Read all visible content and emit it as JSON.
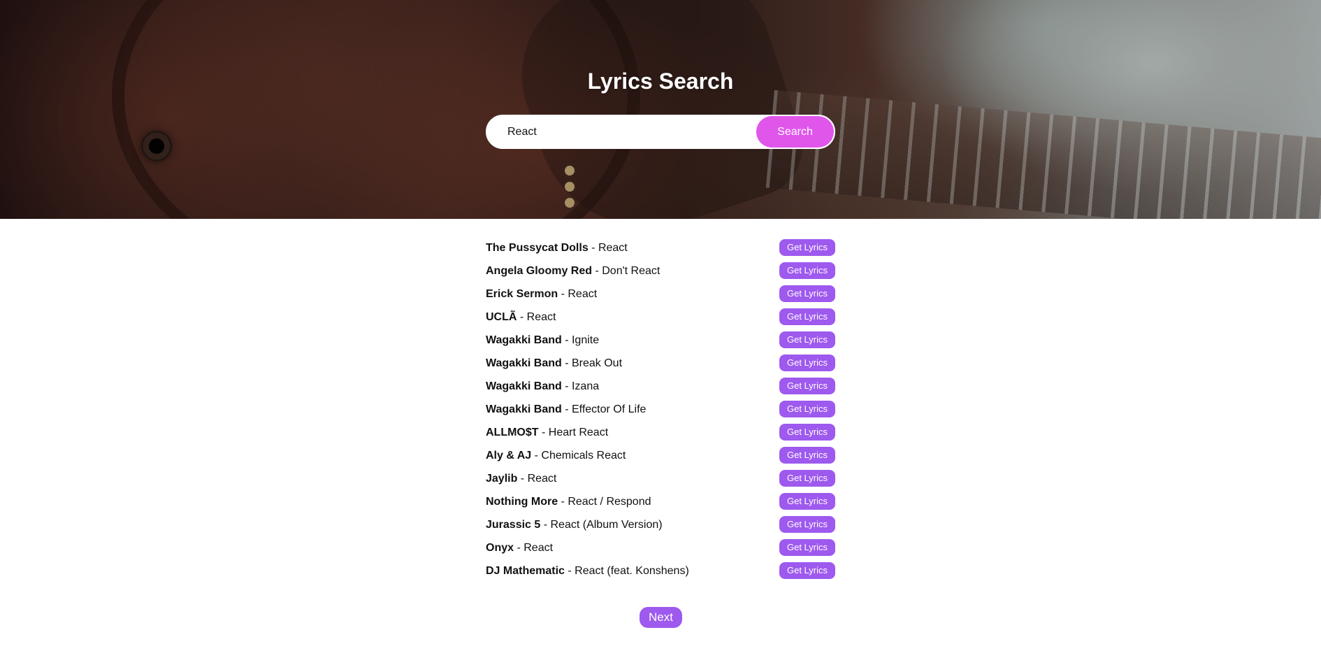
{
  "header": {
    "title": "Lyrics Search"
  },
  "search": {
    "value": "React",
    "button_label": "Search"
  },
  "results": [
    {
      "artist": "The Pussycat Dolls",
      "song": "React",
      "action_label": "Get Lyrics"
    },
    {
      "artist": "Angela Gloomy Red",
      "song": "Don't React",
      "action_label": "Get Lyrics"
    },
    {
      "artist": "Erick Sermon",
      "song": "React",
      "action_label": "Get Lyrics"
    },
    {
      "artist": "UCLÃ",
      "song": "React",
      "action_label": "Get Lyrics"
    },
    {
      "artist": "Wagakki Band",
      "song": "Ignite",
      "action_label": "Get Lyrics"
    },
    {
      "artist": "Wagakki Band",
      "song": "Break Out",
      "action_label": "Get Lyrics"
    },
    {
      "artist": "Wagakki Band",
      "song": "Izana",
      "action_label": "Get Lyrics"
    },
    {
      "artist": "Wagakki Band",
      "song": "Effector Of Life",
      "action_label": "Get Lyrics"
    },
    {
      "artist": "ALLMO$T",
      "song": "Heart React",
      "action_label": "Get Lyrics"
    },
    {
      "artist": "Aly & AJ",
      "song": "Chemicals React",
      "action_label": "Get Lyrics"
    },
    {
      "artist": "Jaylib",
      "song": "React",
      "action_label": "Get Lyrics"
    },
    {
      "artist": "Nothing More",
      "song": "React / Respond",
      "action_label": "Get Lyrics"
    },
    {
      "artist": "Jurassic 5",
      "song": "React (Album Version)",
      "action_label": "Get Lyrics"
    },
    {
      "artist": "Onyx",
      "song": "React",
      "action_label": "Get Lyrics"
    },
    {
      "artist": "DJ Mathematic",
      "song": "React (feat. Konshens)",
      "action_label": "Get Lyrics"
    }
  ],
  "separator": " - ",
  "pagination": {
    "next_label": "Next"
  },
  "colors": {
    "search_button": "#e056ea",
    "action_button": "#9e59ee",
    "title": "#ffffff"
  }
}
